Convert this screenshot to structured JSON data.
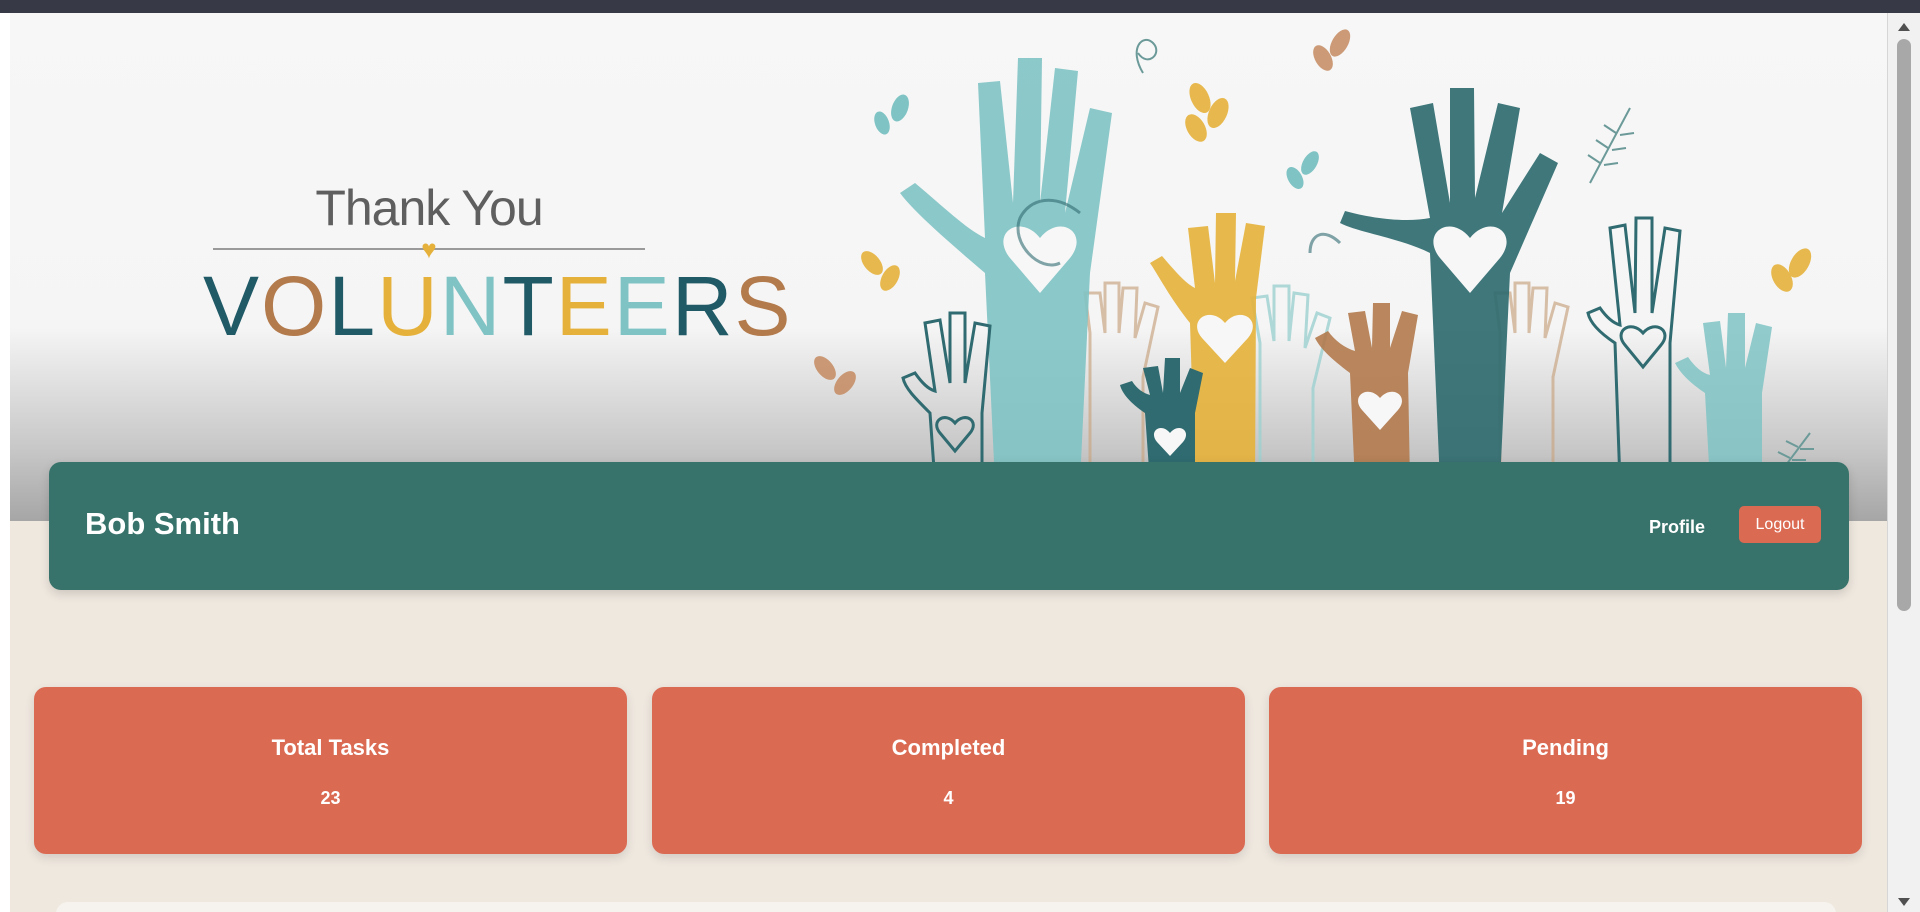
{
  "hero": {
    "thank_text": "Thank You",
    "volunteers_letters": [
      "V",
      "O",
      "L",
      "U",
      "N",
      "T",
      "E",
      "E",
      "R",
      "S"
    ],
    "heart_icon": "heart-icon",
    "colors": {
      "teal": "#7fc3c4",
      "dark_teal": "#2f6b70",
      "gold": "#e6b13a",
      "brown": "#b37a4c"
    }
  },
  "header": {
    "user_name": "Bob Smith",
    "profile_label": "Profile",
    "logout_label": "Logout",
    "bar_color": "#37736b",
    "accent_color": "#db6a53"
  },
  "stats": [
    {
      "title": "Total Tasks",
      "value": "23"
    },
    {
      "title": "Completed",
      "value": "4"
    },
    {
      "title": "Pending",
      "value": "19"
    }
  ]
}
